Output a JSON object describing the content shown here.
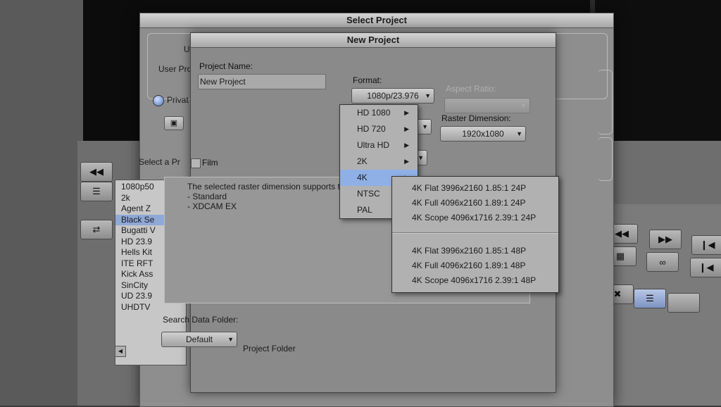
{
  "select_project": {
    "title": "Select Project",
    "user_label": "Us",
    "user_profile_label": "User Prof",
    "private_label": "Privat",
    "select_label": "Select a Pr",
    "projects": [
      "1080p50",
      "2k",
      "Agent Z",
      "Black Se",
      "Bugatti V",
      "HD 23.9",
      "Hells Kit",
      "ITE RFT",
      "Kick Ass",
      "SinCity",
      "UD 23.9",
      "UHDTV"
    ],
    "selected_project_index": 3
  },
  "new_project": {
    "title": "New Project",
    "project_name_label": "Project Name:",
    "project_name_value": "New Project",
    "format_label": "Format:",
    "format_value": "1080p/23.976",
    "aspect_ratio_label": "Aspect Ratio:",
    "raster_dimension_label": "Raster Dimension:",
    "raster_dimension_value": "1920x1080",
    "film_label": "Film",
    "info_lines": [
      "The selected raster dimension supports the following raster t",
      "- Standard",
      "- XDCAM EX"
    ],
    "search_data_folder_label": "Search Data Folder:",
    "search_data_folder_value": "Default",
    "project_folder_label": "Project Folder"
  },
  "format_menu": {
    "items": [
      "HD 1080",
      "HD 720",
      "Ultra HD",
      "2K",
      "4K",
      "NTSC",
      "PAL"
    ],
    "active_index": 4,
    "submenu_group1": [
      "4K Flat 3996x2160 1.85:1 24P",
      "4K Full 4096x2160 1.89:1 24P",
      "4K Scope 4096x1716 2.39:1 24P"
    ],
    "submenu_group2": [
      "4K Flat 3996x2160 1.85:1 48P",
      "4K Full 4096x2160 1.89:1 48P",
      "4K Scope 4096x1716 2.39:1 48P"
    ]
  },
  "colors": {
    "highlight": "#8fb0e6",
    "dialog_bg": "#8a8a8a"
  }
}
